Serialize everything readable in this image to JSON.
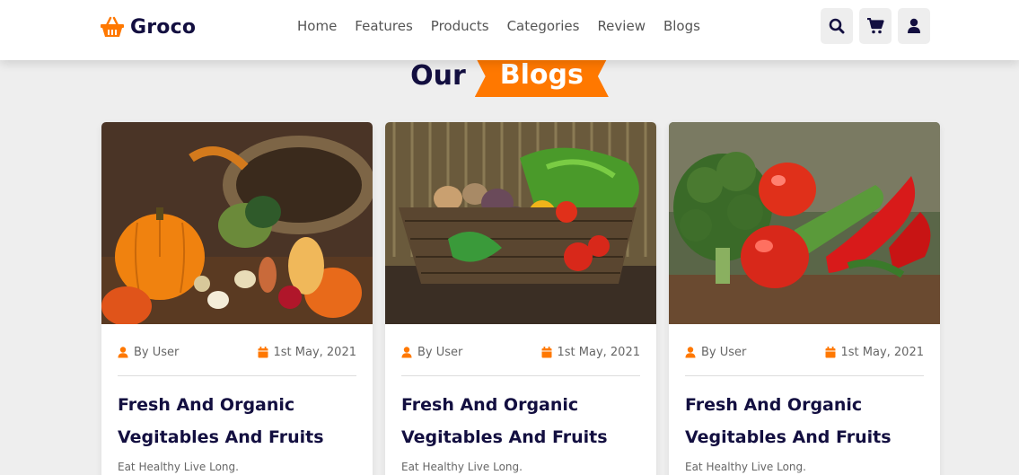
{
  "brand": {
    "name": "Groco",
    "accent": "#ff7800",
    "dark": "#130f40"
  },
  "nav": {
    "items": [
      "Home",
      "Features",
      "Products",
      "Categories",
      "Review",
      "Blogs"
    ]
  },
  "header_icons": [
    "search-icon",
    "cart-icon",
    "user-icon"
  ],
  "section": {
    "title_plain": "Our",
    "title_highlight": "Blogs"
  },
  "blogs": [
    {
      "image": "basket-of-pumpkins-and-vegetables",
      "author": "By User",
      "date": "1st May, 2021",
      "title_line1": "Fresh And Organic",
      "title_line2": "Vegitables And Fruits",
      "description": "Eat Healthy Live Long."
    },
    {
      "image": "wicker-basket-of-vegetables",
      "author": "By User",
      "date": "1st May, 2021",
      "title_line1": "Fresh And Organic",
      "title_line2": "Vegitables And Fruits",
      "description": "Eat Healthy Live Long."
    },
    {
      "image": "broccoli-tomatoes-peppers",
      "author": "By User",
      "date": "1st May, 2021",
      "title_line1": "Fresh And Organic",
      "title_line2": "Vegitables And Fruits",
      "description": "Eat Healthy Live Long."
    }
  ]
}
